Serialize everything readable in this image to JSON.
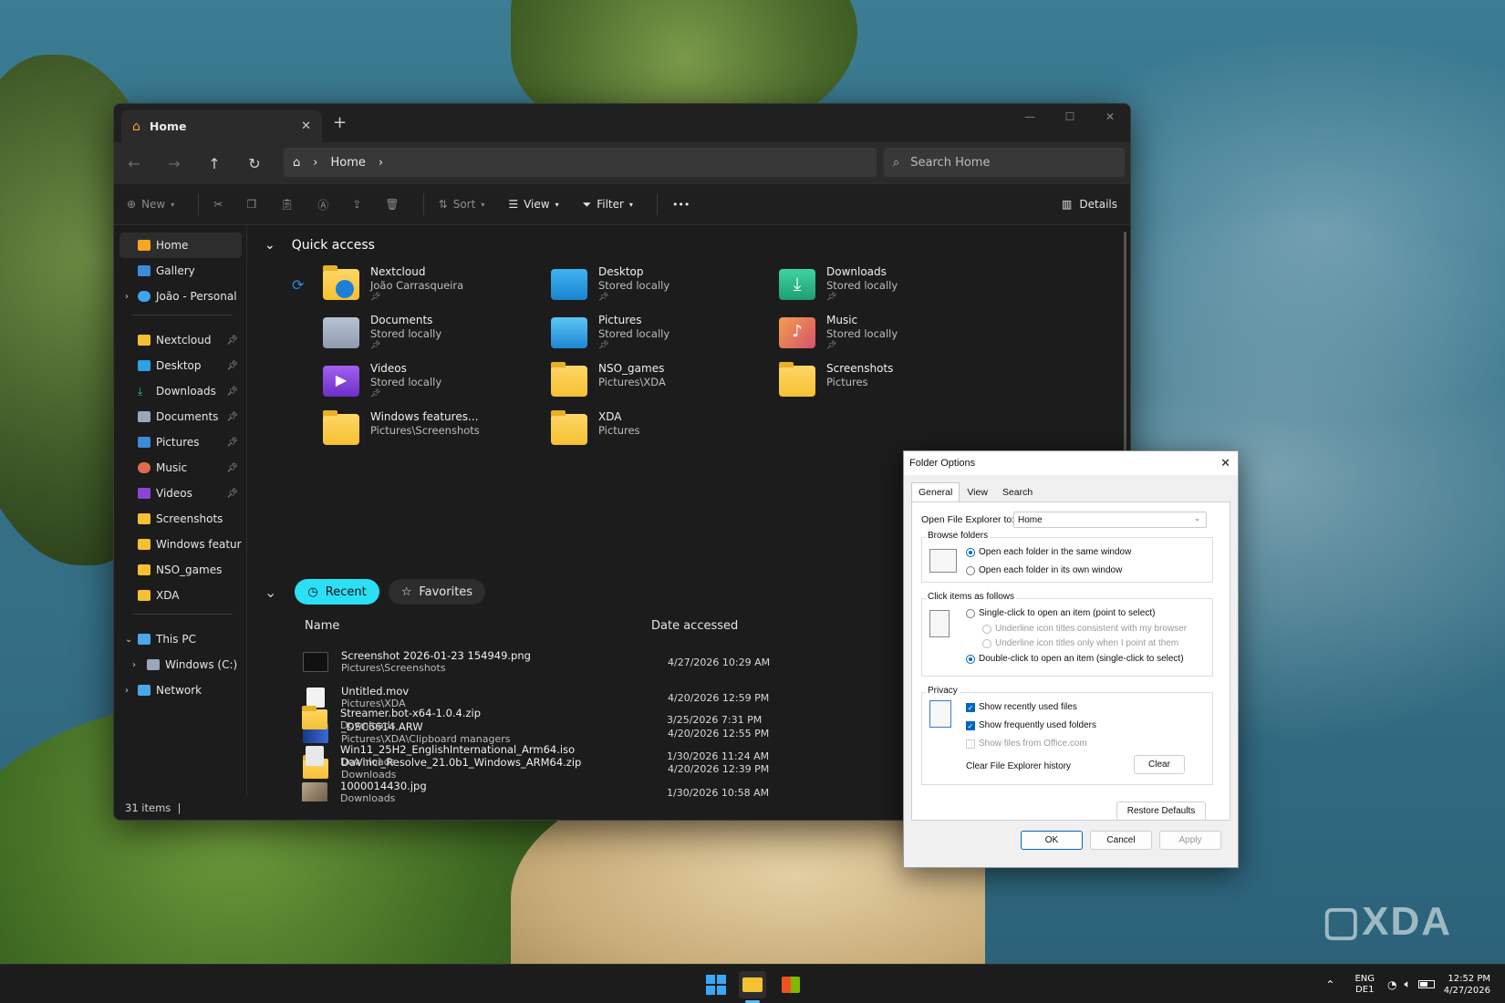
{
  "wallpaper": {
    "watermark": "XDA"
  },
  "explorer": {
    "tab_title": "Home",
    "tab_close": "✕",
    "new_tab": "+",
    "address": {
      "home_icon": "home-icon",
      "segment": "Home"
    },
    "search_placeholder": "Search Home",
    "commands": {
      "new": "New",
      "sort": "Sort",
      "view": "View",
      "filter": "Filter",
      "more": "•••",
      "details": "Details"
    },
    "sidebar": {
      "top": [
        {
          "label": "Home"
        },
        {
          "label": "Gallery"
        },
        {
          "label": "João - Personal"
        }
      ],
      "pinned": [
        {
          "label": "Nextcloud"
        },
        {
          "label": "Desktop"
        },
        {
          "label": "Downloads"
        },
        {
          "label": "Documents"
        },
        {
          "label": "Pictures"
        },
        {
          "label": "Music"
        },
        {
          "label": "Videos"
        },
        {
          "label": "Screenshots"
        },
        {
          "label": "Windows features c"
        },
        {
          "label": "NSO_games"
        },
        {
          "label": "XDA"
        }
      ],
      "devices": [
        {
          "label": "This PC"
        },
        {
          "label": "Windows (C:)"
        },
        {
          "label": "Network"
        }
      ]
    },
    "quick_access": {
      "title": "Quick access",
      "items": [
        {
          "name": "Nextcloud",
          "sub": "João Carrasqueira",
          "pinned": true,
          "icon": "nextcloud-icon"
        },
        {
          "name": "Desktop",
          "sub": "Stored locally",
          "pinned": true,
          "icon": "desktop-folder-icon"
        },
        {
          "name": "Downloads",
          "sub": "Stored locally",
          "pinned": true,
          "icon": "downloads-folder-icon"
        },
        {
          "name": "Documents",
          "sub": "Stored locally",
          "pinned": true,
          "icon": "documents-folder-icon"
        },
        {
          "name": "Pictures",
          "sub": "Stored locally",
          "pinned": true,
          "icon": "pictures-folder-icon"
        },
        {
          "name": "Music",
          "sub": "Stored locally",
          "pinned": true,
          "icon": "music-folder-icon"
        },
        {
          "name": "Videos",
          "sub": "Stored locally",
          "pinned": true,
          "icon": "videos-folder-icon"
        },
        {
          "name": "NSO_games",
          "sub": "Pictures\\XDA",
          "pinned": false,
          "icon": "folder-icon"
        },
        {
          "name": "Screenshots",
          "sub": "Pictures",
          "pinned": false,
          "icon": "folder-icon"
        },
        {
          "name": "Windows features...",
          "sub": "Pictures\\Screenshots",
          "pinned": false,
          "icon": "folder-icon"
        },
        {
          "name": "XDA",
          "sub": "Pictures",
          "pinned": false,
          "icon": "folder-icon"
        }
      ]
    },
    "recent": {
      "recent_label": "Recent",
      "favorites_label": "Favorites",
      "col_name": "Name",
      "col_date": "Date accessed",
      "files": [
        {
          "name": "Screenshot 2026-01-23 154949.png",
          "path": "Pictures\\Screenshots",
          "date": "4/27/2026 10:29 AM",
          "icon": "image-file-icon"
        },
        {
          "name": "Untitled.mov",
          "path": "Pictures\\XDA",
          "date": "4/20/2026 12:59 PM",
          "icon": "blank-file-icon"
        },
        {
          "name": "_DSC6614.ARW",
          "path": "Pictures\\XDA\\Clipboard managers",
          "date": "4/20/2026 12:55 PM",
          "icon": "raw-image-icon"
        },
        {
          "name": "DaVinci_Resolve_21.0b1_Windows_ARM64.zip",
          "path": "Downloads",
          "date": "4/20/2026 12:39 PM",
          "icon": "zip-file-icon"
        },
        {
          "name": "Streamer.bot-x64-1.0.4.zip",
          "path": "Downloads",
          "date": "3/25/2026 7:31 PM",
          "icon": "zip-file-icon"
        },
        {
          "name": "Win11_25H2_EnglishInternational_Arm64.iso",
          "path": "Downloads",
          "date": "1/30/2026 11:24 AM",
          "icon": "disc-image-icon"
        },
        {
          "name": "1000014430.jpg",
          "path": "Downloads",
          "date": "1/30/2026 10:58 AM",
          "icon": "photo-file-icon"
        }
      ]
    },
    "status": "31 items"
  },
  "folder_options": {
    "title": "Folder Options",
    "tabs": [
      "General",
      "View",
      "Search"
    ],
    "open_to_label": "Open File Explorer to:",
    "open_to_value": "Home",
    "browse_label": "Browse folders",
    "browse_same": "Open each folder in the same window",
    "browse_own": "Open each folder in its own window",
    "click_label": "Click items as follows",
    "single_click": "Single-click to open an item (point to select)",
    "underline_browser": "Underline icon titles consistent with my browser",
    "underline_point": "Underline icon titles only when I point at them",
    "double_click": "Double-click to open an item (single-click to select)",
    "privacy_label": "Privacy",
    "show_recent": "Show recently used files",
    "show_frequent": "Show frequently used folders",
    "show_office": "Show files from Office.com",
    "clear_history_label": "Clear File Explorer history",
    "clear": "Clear",
    "restore": "Restore Defaults",
    "ok": "OK",
    "cancel": "Cancel",
    "apply": "Apply"
  },
  "taskbar": {
    "lang_top": "ENG",
    "lang_bottom": "DE1",
    "time": "12:52 PM",
    "date": "4/27/2026"
  },
  "colors": {
    "accent": "#2bdff5",
    "dialog_accent": "#0067c0",
    "explorer_bg": "#1c1c1c"
  }
}
